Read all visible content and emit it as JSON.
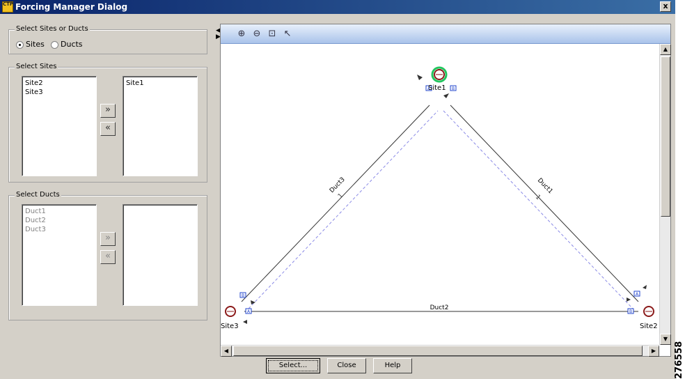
{
  "window": {
    "title": "Forcing Manager Dialog",
    "title_icon": "CTP",
    "close_label": "x"
  },
  "mode_group": {
    "legend": "Select Sites or Ducts",
    "options": [
      {
        "label": "Sites",
        "selected": true
      },
      {
        "label": "Ducts",
        "selected": false
      }
    ]
  },
  "sites_group": {
    "legend": "Select Sites",
    "available": [
      "Site2",
      "Site3"
    ],
    "selected": [
      "Site1"
    ],
    "add_icon": "»",
    "remove_icon": "«"
  },
  "ducts_group": {
    "legend": "Select Ducts",
    "available": [
      "Duct1",
      "Duct2",
      "Duct3"
    ],
    "selected": [],
    "add_icon": "»",
    "remove_icon": "«"
  },
  "toolbar": {
    "icons": [
      "zoom-in-icon",
      "zoom-out-icon",
      "zoom-fit-icon",
      "select-icon"
    ]
  },
  "network": {
    "sites": [
      {
        "label": "Site1",
        "highlight_color": "#22c55e"
      },
      {
        "label": "Site2"
      },
      {
        "label": "Site3"
      }
    ],
    "ducts": [
      {
        "label": "Duct1",
        "count": "1"
      },
      {
        "label": "Duct2"
      },
      {
        "label": "Duct3",
        "count": "1"
      }
    ],
    "port_a": "A",
    "port_b": "B"
  },
  "buttons": {
    "select": "Select...",
    "close": "Close",
    "help": "Help"
  },
  "figure_number": "276558"
}
